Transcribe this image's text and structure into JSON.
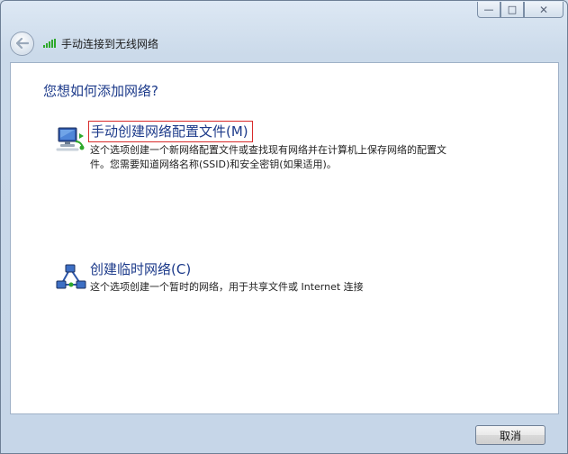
{
  "window": {
    "title": "手动连接到无线网络",
    "caption": {
      "minimize": "—",
      "maximize": "□",
      "close": "✕"
    }
  },
  "main": {
    "question": "您想如何添加网络?",
    "options": [
      {
        "title": "手动创建网络配置文件(M)",
        "desc_line1": "这个选项创建一个新网络配置文件或查找现有网络并在计算机上保存网络的配置文",
        "desc_line2": "件。您需要知道网络名称(SSID)和安全密钥(如果适用)。",
        "icon": "network-computer-icon"
      },
      {
        "title": "创建临时网络(C)",
        "desc": "这个选项创建一个暂时的网络，用于共享文件或 Internet 连接",
        "icon": "ad-hoc-network-icon"
      }
    ]
  },
  "footer": {
    "cancel_label": "取消"
  },
  "colors": {
    "link_blue": "#1c3a8a",
    "highlight_red": "#d82b2b",
    "signal_green": "#2ea82a"
  }
}
